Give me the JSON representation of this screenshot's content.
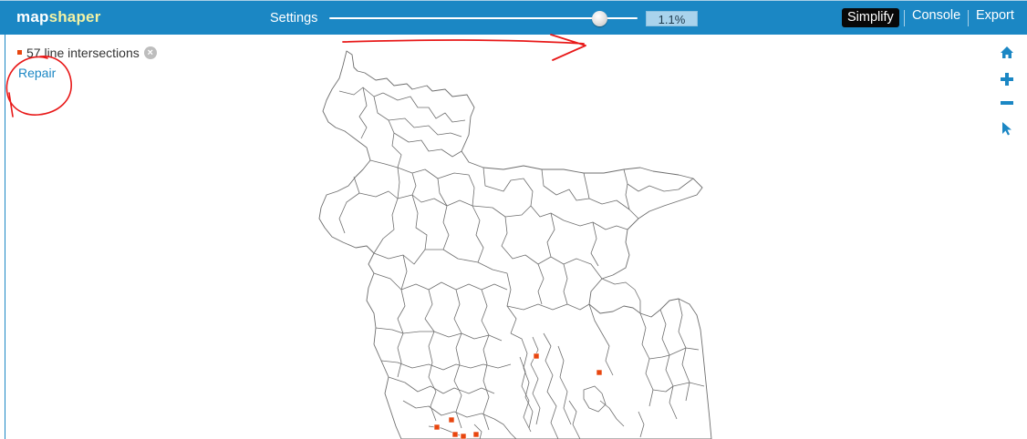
{
  "app": {
    "logo_part1": "map",
    "logo_part2": "shaper"
  },
  "toolbar": {
    "settings_label": "Settings",
    "simplify_percent": "1.1%",
    "simplify_label": "Simplify",
    "console_label": "Console",
    "export_label": "Export",
    "slider_value": 0.85
  },
  "intersections": {
    "text": "57 line intersections"
  },
  "repair": {
    "label": "Repair"
  },
  "map_tools": {
    "home_icon": "home-icon",
    "zoom_in_icon": "plus-icon",
    "zoom_out_icon": "minus-icon",
    "pointer_icon": "pointer-icon"
  },
  "colors": {
    "topbar": "#1b87c4",
    "accent": "#1b87c4",
    "active_menu": "#080808",
    "intersection_marker": "#e8460f",
    "annotation": "#e81919"
  }
}
